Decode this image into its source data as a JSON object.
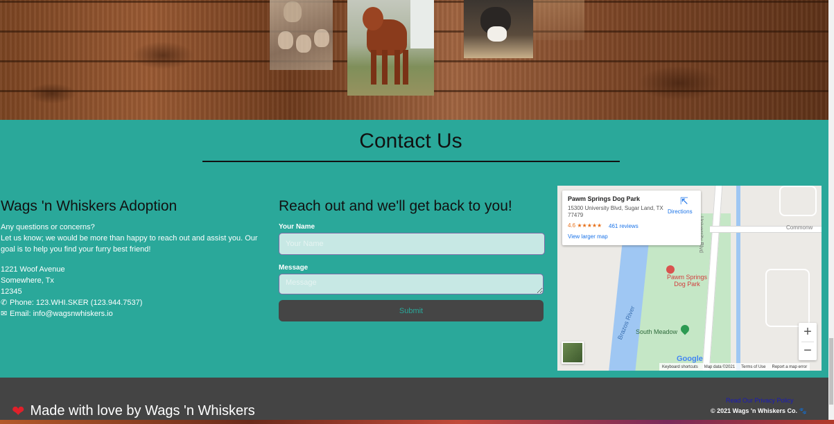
{
  "contact": {
    "title": "Contact Us",
    "about": {
      "heading": "Wags 'n Whiskers Adoption",
      "intro_line1": "Any questions or concerns?",
      "intro_line2": "Let us know; we would be more than happy to reach out and assist you. Our goal is to help you find your furry best friend!",
      "street": "1221 Woof Avenue",
      "city": "Somewhere, Tx",
      "zip": "12345",
      "phone": "Phone: 123.WHI.SKER (123.944.7537)",
      "email": "Email: info@wagsnwhiskers.io"
    },
    "form": {
      "heading": "Reach out and we'll get back to you!",
      "name_label": "Your Name",
      "name_placeholder": "Your Name",
      "name_value": "",
      "message_label": "Message",
      "message_placeholder": "Message",
      "message_value": "",
      "submit_label": "Submit"
    }
  },
  "map": {
    "place_name": "Pawm Springs Dog Park",
    "address": "15300 University Blvd, Sugar Land, TX 77479",
    "rating": "4.6 ★★★★★",
    "reviews": "461 reviews",
    "directions": "Directions",
    "larger_map": "View larger map",
    "label_park": "Pawm Springs Dog Park",
    "label_meadow": "South Meadow",
    "label_river": "Brazos River",
    "label_blvd": "University Blvd",
    "label_road": "Commonw",
    "google": "Google",
    "zoom_in": "+",
    "zoom_out": "−",
    "attribution": [
      "Keyboard shortcuts",
      "Map data ©2021",
      "Terms of Use",
      "Report a map error"
    ]
  },
  "footer": {
    "made_with_love": "Made with love by Wags 'n Whiskers",
    "privacy": "Read Our Privacy Policy",
    "copyright": "© 2021 Wags 'n Whiskers Co. 🐾"
  },
  "icons": {
    "phone": "phone-icon",
    "email": "envelope-icon",
    "heart": "heart-icon",
    "directions": "directions-icon"
  },
  "colors": {
    "teal": "#2aa89a",
    "footer": "#444444",
    "submit_bg": "#454545"
  }
}
